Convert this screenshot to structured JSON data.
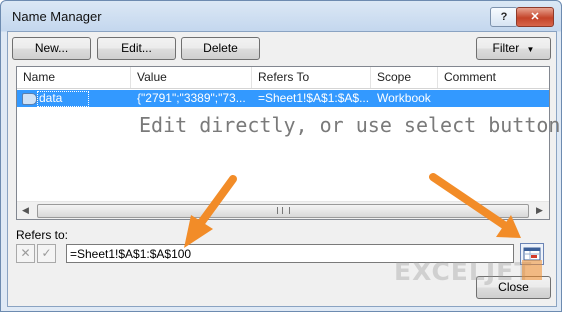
{
  "window": {
    "title": "Name Manager",
    "help_label": "?",
    "close_label": "✕"
  },
  "toolbar": {
    "new_label": "New...",
    "edit_label": "Edit...",
    "delete_label": "Delete",
    "filter_label": "Filter"
  },
  "list": {
    "columns": [
      "Name",
      "Value",
      "Refers To",
      "Scope",
      "Comment"
    ],
    "rows": [
      {
        "name": "data",
        "value": "{\"2791\";\"3389\";\"73...",
        "refers_to": "=Sheet1!$A$1:$A$...",
        "scope": "Workbook",
        "comment": ""
      }
    ]
  },
  "refers": {
    "label": "Refers to:",
    "value": "=Sheet1!$A$1:$A$100",
    "cancel_glyph": "✕",
    "enter_glyph": "✓"
  },
  "footer": {
    "close_label": "Close"
  },
  "annotation": {
    "text": "Edit directly, or use select button",
    "color": "#f28c28"
  },
  "watermark": {
    "text": "EXCELJET"
  },
  "colors": {
    "selection": "#3399ff",
    "title_bg": "#c4d7ee",
    "client_bg": "#f0f0f0"
  }
}
